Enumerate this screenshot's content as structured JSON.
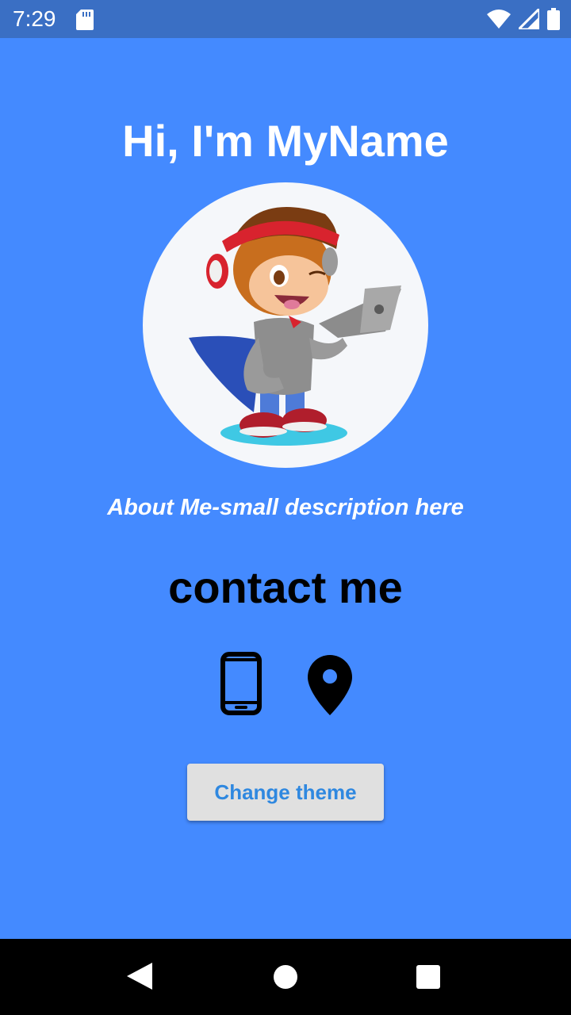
{
  "status_bar": {
    "time": "7:29",
    "icons": [
      "sd-card-icon",
      "wifi-icon",
      "signal-icon",
      "battery-icon"
    ]
  },
  "profile": {
    "title": "Hi, I'm MyName",
    "avatar": "cartoon-octocat-avatar",
    "about": "About Me-small description here"
  },
  "contact": {
    "heading": "contact me",
    "icons": [
      "phone-icon",
      "location-pin-icon"
    ]
  },
  "actions": {
    "change_theme_label": "Change theme"
  },
  "nav_bar": {
    "buttons": [
      "back-icon",
      "home-icon",
      "recents-icon"
    ]
  },
  "colors": {
    "background": "#448AFF",
    "status_bar": "#3A6FC4",
    "button_bg": "#E0E0E0",
    "button_text": "#2F88E0"
  }
}
